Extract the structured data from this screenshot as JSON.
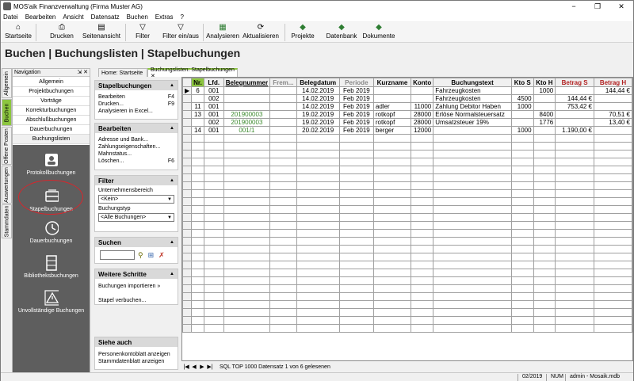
{
  "window": {
    "title": "MOS'aik Finanzverwaltung (Firma Muster AG)",
    "controls": [
      "−",
      "❐",
      "✕"
    ]
  },
  "menu": [
    "Datei",
    "Bearbeiten",
    "Ansicht",
    "Datensatz",
    "Buchen",
    "Extras",
    "?"
  ],
  "toolbar": [
    {
      "label": "Startseite",
      "icon": "home-icon"
    },
    {
      "label": "Drucken",
      "icon": "print-icon"
    },
    {
      "label": "Seitenansicht",
      "icon": "page-preview-icon"
    },
    {
      "label": "Filter",
      "icon": "filter-icon"
    },
    {
      "label": "Filter ein/aus",
      "icon": "filter-toggle-icon"
    },
    {
      "label": "Analysieren",
      "icon": "analyze-icon"
    },
    {
      "label": "Aktualisieren",
      "icon": "refresh-icon"
    },
    {
      "label": "Projekte",
      "icon": "projects-icon"
    },
    {
      "label": "Datenbank",
      "icon": "database-icon"
    },
    {
      "label": "Dokumente",
      "icon": "documents-icon"
    }
  ],
  "page_title": "Buchen | Buchungslisten | Stapelbuchungen",
  "vertical_tabs": [
    "Allgemein",
    "Buchen",
    "Offene Posten",
    "Auswertungen",
    "Stammdaten"
  ],
  "navigation": {
    "header": "Navigation",
    "pin": "⇲ ✕",
    "items": [
      "Allgemein",
      "Projektbuchungen",
      "Vorträge",
      "Korrekturbuchungen",
      "Abschlußbuchungen",
      "Dauerbuchungen",
      "Buchungslisten"
    ],
    "big_buttons": [
      "Protokollbuchungen",
      "Stapelbuchungen",
      "Dauerbuchungen",
      "Bibliotheksbuchungen",
      "Unvollständige Buchungen"
    ]
  },
  "tabs": [
    "Home: Startseite",
    "Buchungslisten: Stapelbuchungen ✕"
  ],
  "task_panel": {
    "stapelbuchungen": {
      "title": "Stapelbuchungen",
      "rows": [
        [
          "Bearbeiten",
          "F4"
        ],
        [
          "Drucken...",
          "F9"
        ],
        [
          "Analysieren in Excel...",
          ""
        ]
      ]
    },
    "bearbeiten": {
      "title": "Bearbeiten",
      "rows": [
        [
          "Adresse und Bank...",
          ""
        ],
        [
          "Zahlungseigenschaften...",
          ""
        ],
        [
          "Mahnstatus...",
          ""
        ],
        [
          "Löschen...",
          "F6"
        ]
      ]
    },
    "filter": {
      "title": "Filter",
      "label1": "Unternehmensbereich",
      "value1": "<Kein>",
      "label2": "Buchungstyp",
      "value2": "<Alle Buchungen>"
    },
    "suchen": {
      "title": "Suchen",
      "value": ""
    },
    "weitere": {
      "title": "Weitere Schritte",
      "rows": [
        "Buchungen importieren »",
        "Stapel verbuchen..."
      ]
    },
    "siehe": {
      "title": "Siehe auch",
      "rows": [
        "Personenkontoblatt anzeigen",
        "Stammdatenblatt anzeigen"
      ]
    }
  },
  "grid": {
    "headers": [
      "Nr.",
      "Lfd.",
      "Belegnummer",
      "Frem...",
      "Belegdatum",
      "Periode",
      "Kurzname",
      "Konto",
      "Buchungstext",
      "Kto S",
      "Kto H",
      "Betrag S",
      "Betrag H"
    ],
    "rows": [
      [
        "6",
        "001",
        "",
        "",
        "14.02.2019",
        "Feb 2019",
        "",
        "",
        "Fahrzeugkosten",
        "",
        "1000",
        "",
        "144,44 €"
      ],
      [
        "",
        "002",
        "",
        "",
        "14.02.2019",
        "Feb 2019",
        "",
        "",
        "Fahrzeugkosten",
        "4500",
        "",
        "144,44 €",
        ""
      ],
      [
        "11",
        "001",
        "",
        "",
        "14.02.2019",
        "Feb 2019",
        "adler",
        "11000",
        "Zahlung Debitor Haben",
        "1000",
        "",
        "753,42 €",
        ""
      ],
      [
        "13",
        "001",
        "201900003",
        "",
        "19.02.2019",
        "Feb 2019",
        "rotkopf",
        "28000",
        "Erlöse Normalsteuersatz",
        "",
        "8400",
        "",
        "70,51 €"
      ],
      [
        "",
        "002",
        "201900003",
        "",
        "19.02.2019",
        "Feb 2019",
        "rotkopf",
        "28000",
        "Umsatzsteuer 19%",
        "",
        "1776",
        "",
        "13,40 €"
      ],
      [
        "14",
        "001",
        "001/1",
        "",
        "20.02.2019",
        "Feb 2019",
        "berger",
        "12000",
        "",
        "1000",
        "",
        "1.190,00 €",
        ""
      ]
    ]
  },
  "record_nav": {
    "buttons": [
      "|◀",
      "◀",
      "▶",
      "▶|"
    ],
    "text": "SQL TOP 1000 Datensatz 1 von 6 gelesenen"
  },
  "status": {
    "period": "02/2019",
    "num": "NUM",
    "user": "admin - Mosaik.mdb"
  }
}
